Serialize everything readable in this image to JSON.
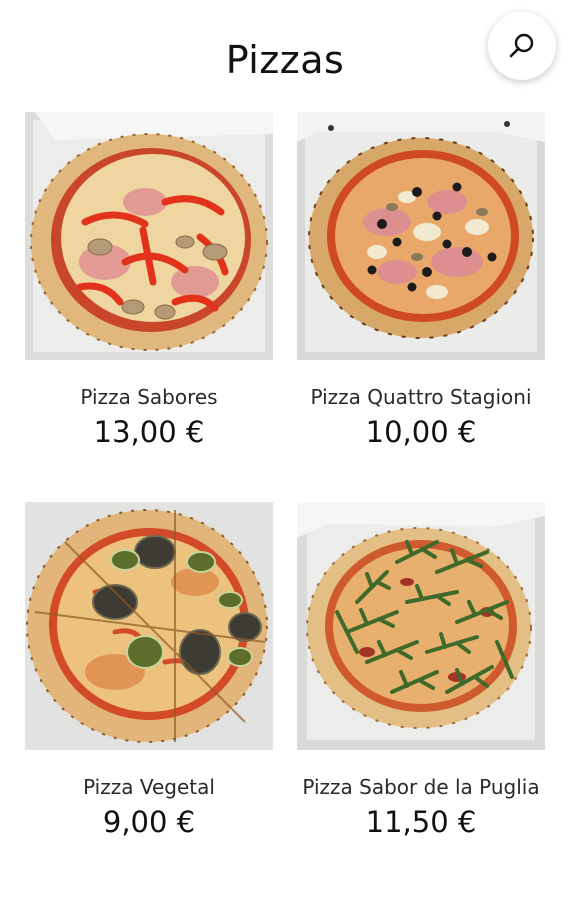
{
  "header": {
    "title": "Pizzas",
    "search_icon": "search-icon"
  },
  "pizzas": [
    {
      "name": "Pizza Sabores",
      "price": "13,00 €"
    },
    {
      "name": "Pizza Quattro Stagioni",
      "price": "10,00 €"
    },
    {
      "name": "Pizza Vegetal",
      "price": "9,00 €"
    },
    {
      "name": "Pizza Sabor de la Puglia",
      "price": "11,50 €"
    }
  ],
  "colors": {
    "background": "#ffffff",
    "text": "#111111",
    "crust": "#e2b97a",
    "sauce": "#c4472a",
    "cheese": "#f0d9a4",
    "box": "#e6e6e4"
  }
}
